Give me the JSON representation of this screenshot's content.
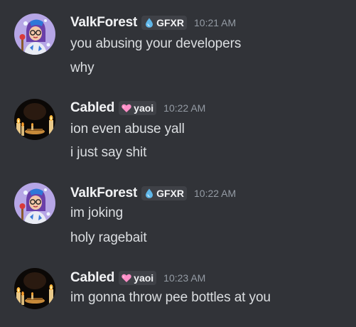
{
  "messages": [
    {
      "author": "ValkForest",
      "tag_label": "GFXR",
      "tag_icon": "droplet-icon",
      "time": "10:21 AM",
      "lines": [
        "you abusing your developers",
        "why"
      ]
    },
    {
      "author": "Cabled",
      "tag_label": "yaoi",
      "tag_icon": "heart-icon",
      "time": "10:22 AM",
      "lines": [
        "ion even abuse yall",
        "i just say shit"
      ]
    },
    {
      "author": "ValkForest",
      "tag_label": "GFXR",
      "tag_icon": "droplet-icon",
      "time": "10:22 AM",
      "lines": [
        "im joking",
        "holy ragebait"
      ]
    },
    {
      "author": "Cabled",
      "tag_label": "yaoi",
      "tag_icon": "heart-icon",
      "time": "10:23 AM",
      "lines": [
        "im gonna throw pee bottles at you"
      ]
    }
  ],
  "colors": {
    "background": "#313338",
    "username": "#f2f3f5",
    "message_text": "#dbdee1",
    "timestamp": "#949ba4",
    "tag_background": "#3f4147",
    "gfxr_tag_icon": "#5fb6e8",
    "yaoi_tag_icon": "#ff8fc8"
  }
}
